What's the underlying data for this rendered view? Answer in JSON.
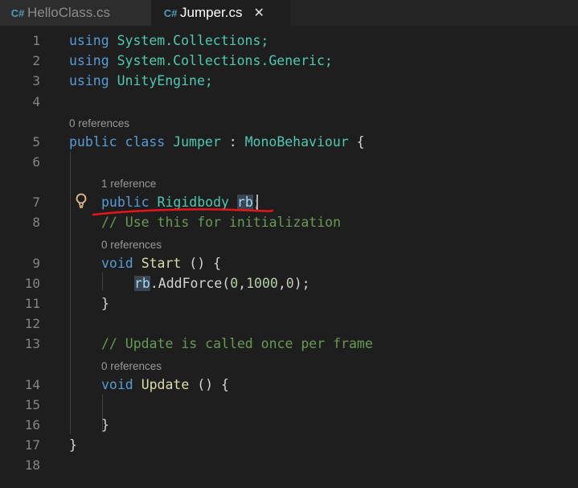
{
  "tabs": [
    {
      "label": "HelloClass.cs",
      "icon": "csharp-file-icon",
      "icon_glyph": "C#"
    },
    {
      "label": "Jumper.cs",
      "icon": "csharp-file-icon",
      "icon_glyph": "C#",
      "close_glyph": "✕"
    }
  ],
  "lines": [
    {
      "n": "1"
    },
    {
      "n": "2"
    },
    {
      "n": "3"
    },
    {
      "n": "4"
    },
    {
      "n": "5"
    },
    {
      "n": "6"
    },
    {
      "n": "7"
    },
    {
      "n": "8"
    },
    {
      "n": "9"
    },
    {
      "n": "10"
    },
    {
      "n": "11"
    },
    {
      "n": "12"
    },
    {
      "n": "13"
    },
    {
      "n": "14"
    },
    {
      "n": "15"
    },
    {
      "n": "16"
    },
    {
      "n": "17"
    },
    {
      "n": "18"
    }
  ],
  "code": {
    "l1_kw": "using",
    "l1_rest": " System.Collections;",
    "l2_kw": "using",
    "l2_rest": " System.Collections.Generic;",
    "l3_kw": "using",
    "l3_rest": " UnityEngine;",
    "l5_kw": "public class",
    "l5_name": "Jumper",
    "l5_colon": " : ",
    "l5_base": "MonoBehaviour",
    "l5_brace": " {",
    "l7_kw": "public",
    "l7_type": "Rigidbody",
    "l7_var": "rb",
    "l7_semi": ";",
    "l8_comment": "// Use this for initialization",
    "l9_kw": "void",
    "l9_fn": "Start",
    "l9_rest": " () {",
    "l10_var": "rb",
    "l10_method": ".AddForce(",
    "l10_n1": "0",
    "l10_c1": ",",
    "l10_n2": "1000",
    "l10_c2": ",",
    "l10_n3": "0",
    "l10_end": ");",
    "l11": "}",
    "l13_comment": "// Update is called once per frame",
    "l14_kw": "void",
    "l14_fn": "Update",
    "l14_rest": " () {",
    "l16": "}",
    "l17": "}"
  },
  "codelens": {
    "before_class": "0 references",
    "before_field": "1 reference",
    "before_start": "0 references",
    "before_update": "0 references"
  },
  "colors": {
    "editor_bg": "#1e1e1e",
    "keyword": "#569cd6",
    "type": "#4ec9b0",
    "function": "#dcdcaa",
    "comment": "#6a9955",
    "number": "#b5cea8",
    "annotation": "#e8141a"
  }
}
